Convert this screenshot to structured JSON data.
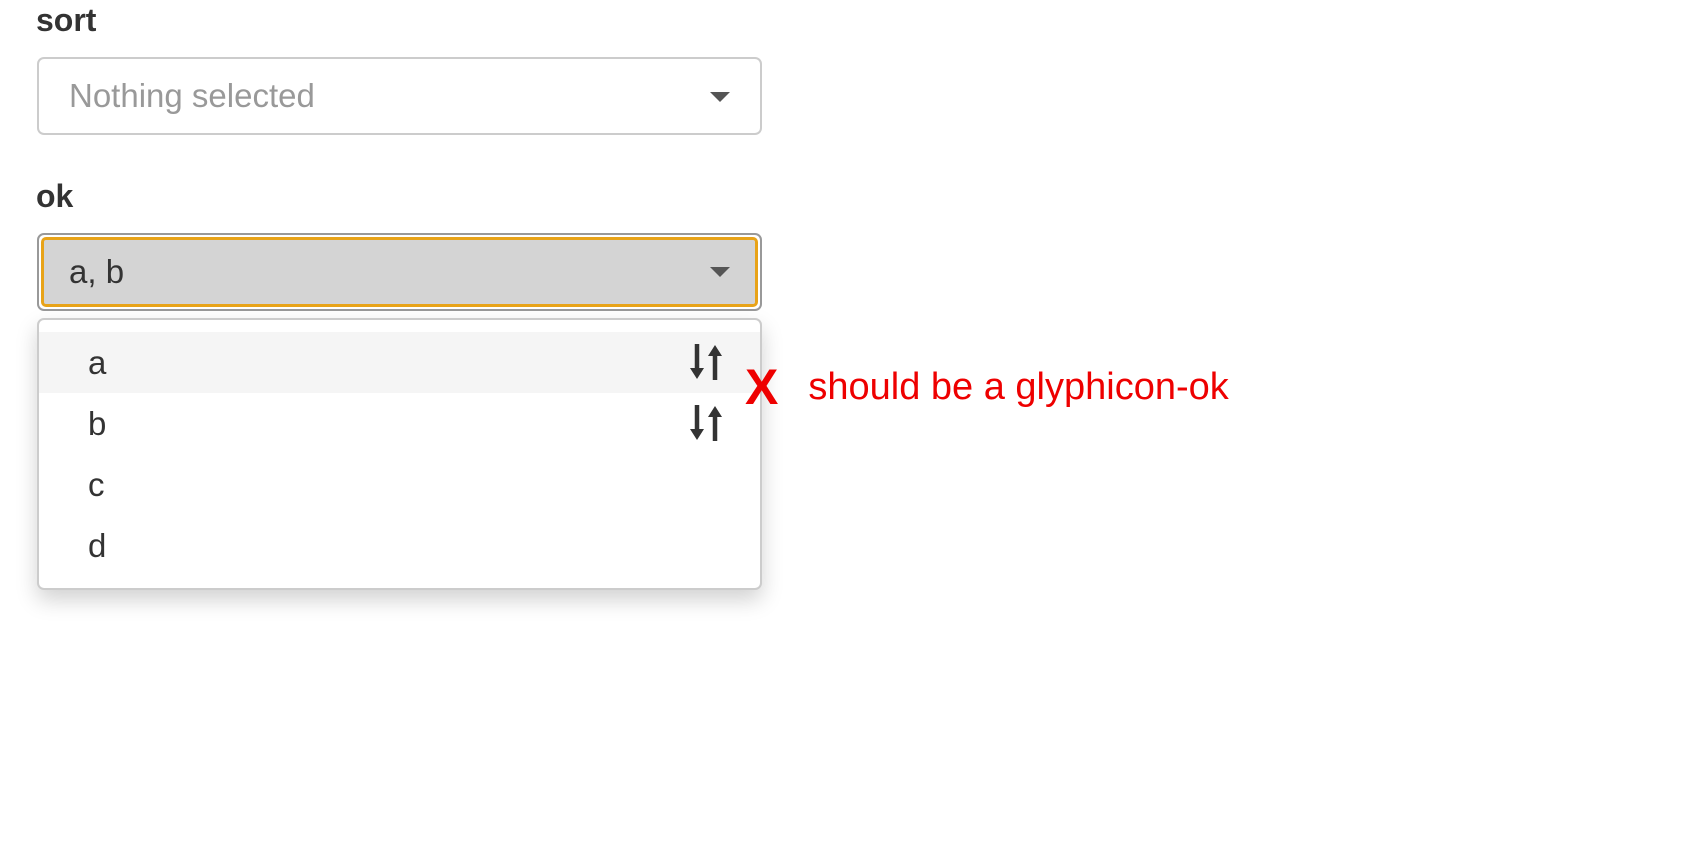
{
  "sort": {
    "label": "sort",
    "placeholder": "Nothing selected"
  },
  "ok": {
    "label": "ok",
    "selected_text": "a, b",
    "options": [
      {
        "label": "a",
        "selected": true,
        "check_icon": "sort-arrows-icon"
      },
      {
        "label": "b",
        "selected": true,
        "check_icon": "sort-arrows-icon"
      },
      {
        "label": "c",
        "selected": false
      },
      {
        "label": "d",
        "selected": false
      }
    ]
  },
  "annotation": {
    "mark": "X",
    "text": "should be a glyphicon-ok",
    "color": "#ee0000"
  },
  "colors": {
    "focus_border": "#e8a318",
    "selected_bg": "#d4d4d4",
    "hover_bg": "#f5f5f5"
  }
}
